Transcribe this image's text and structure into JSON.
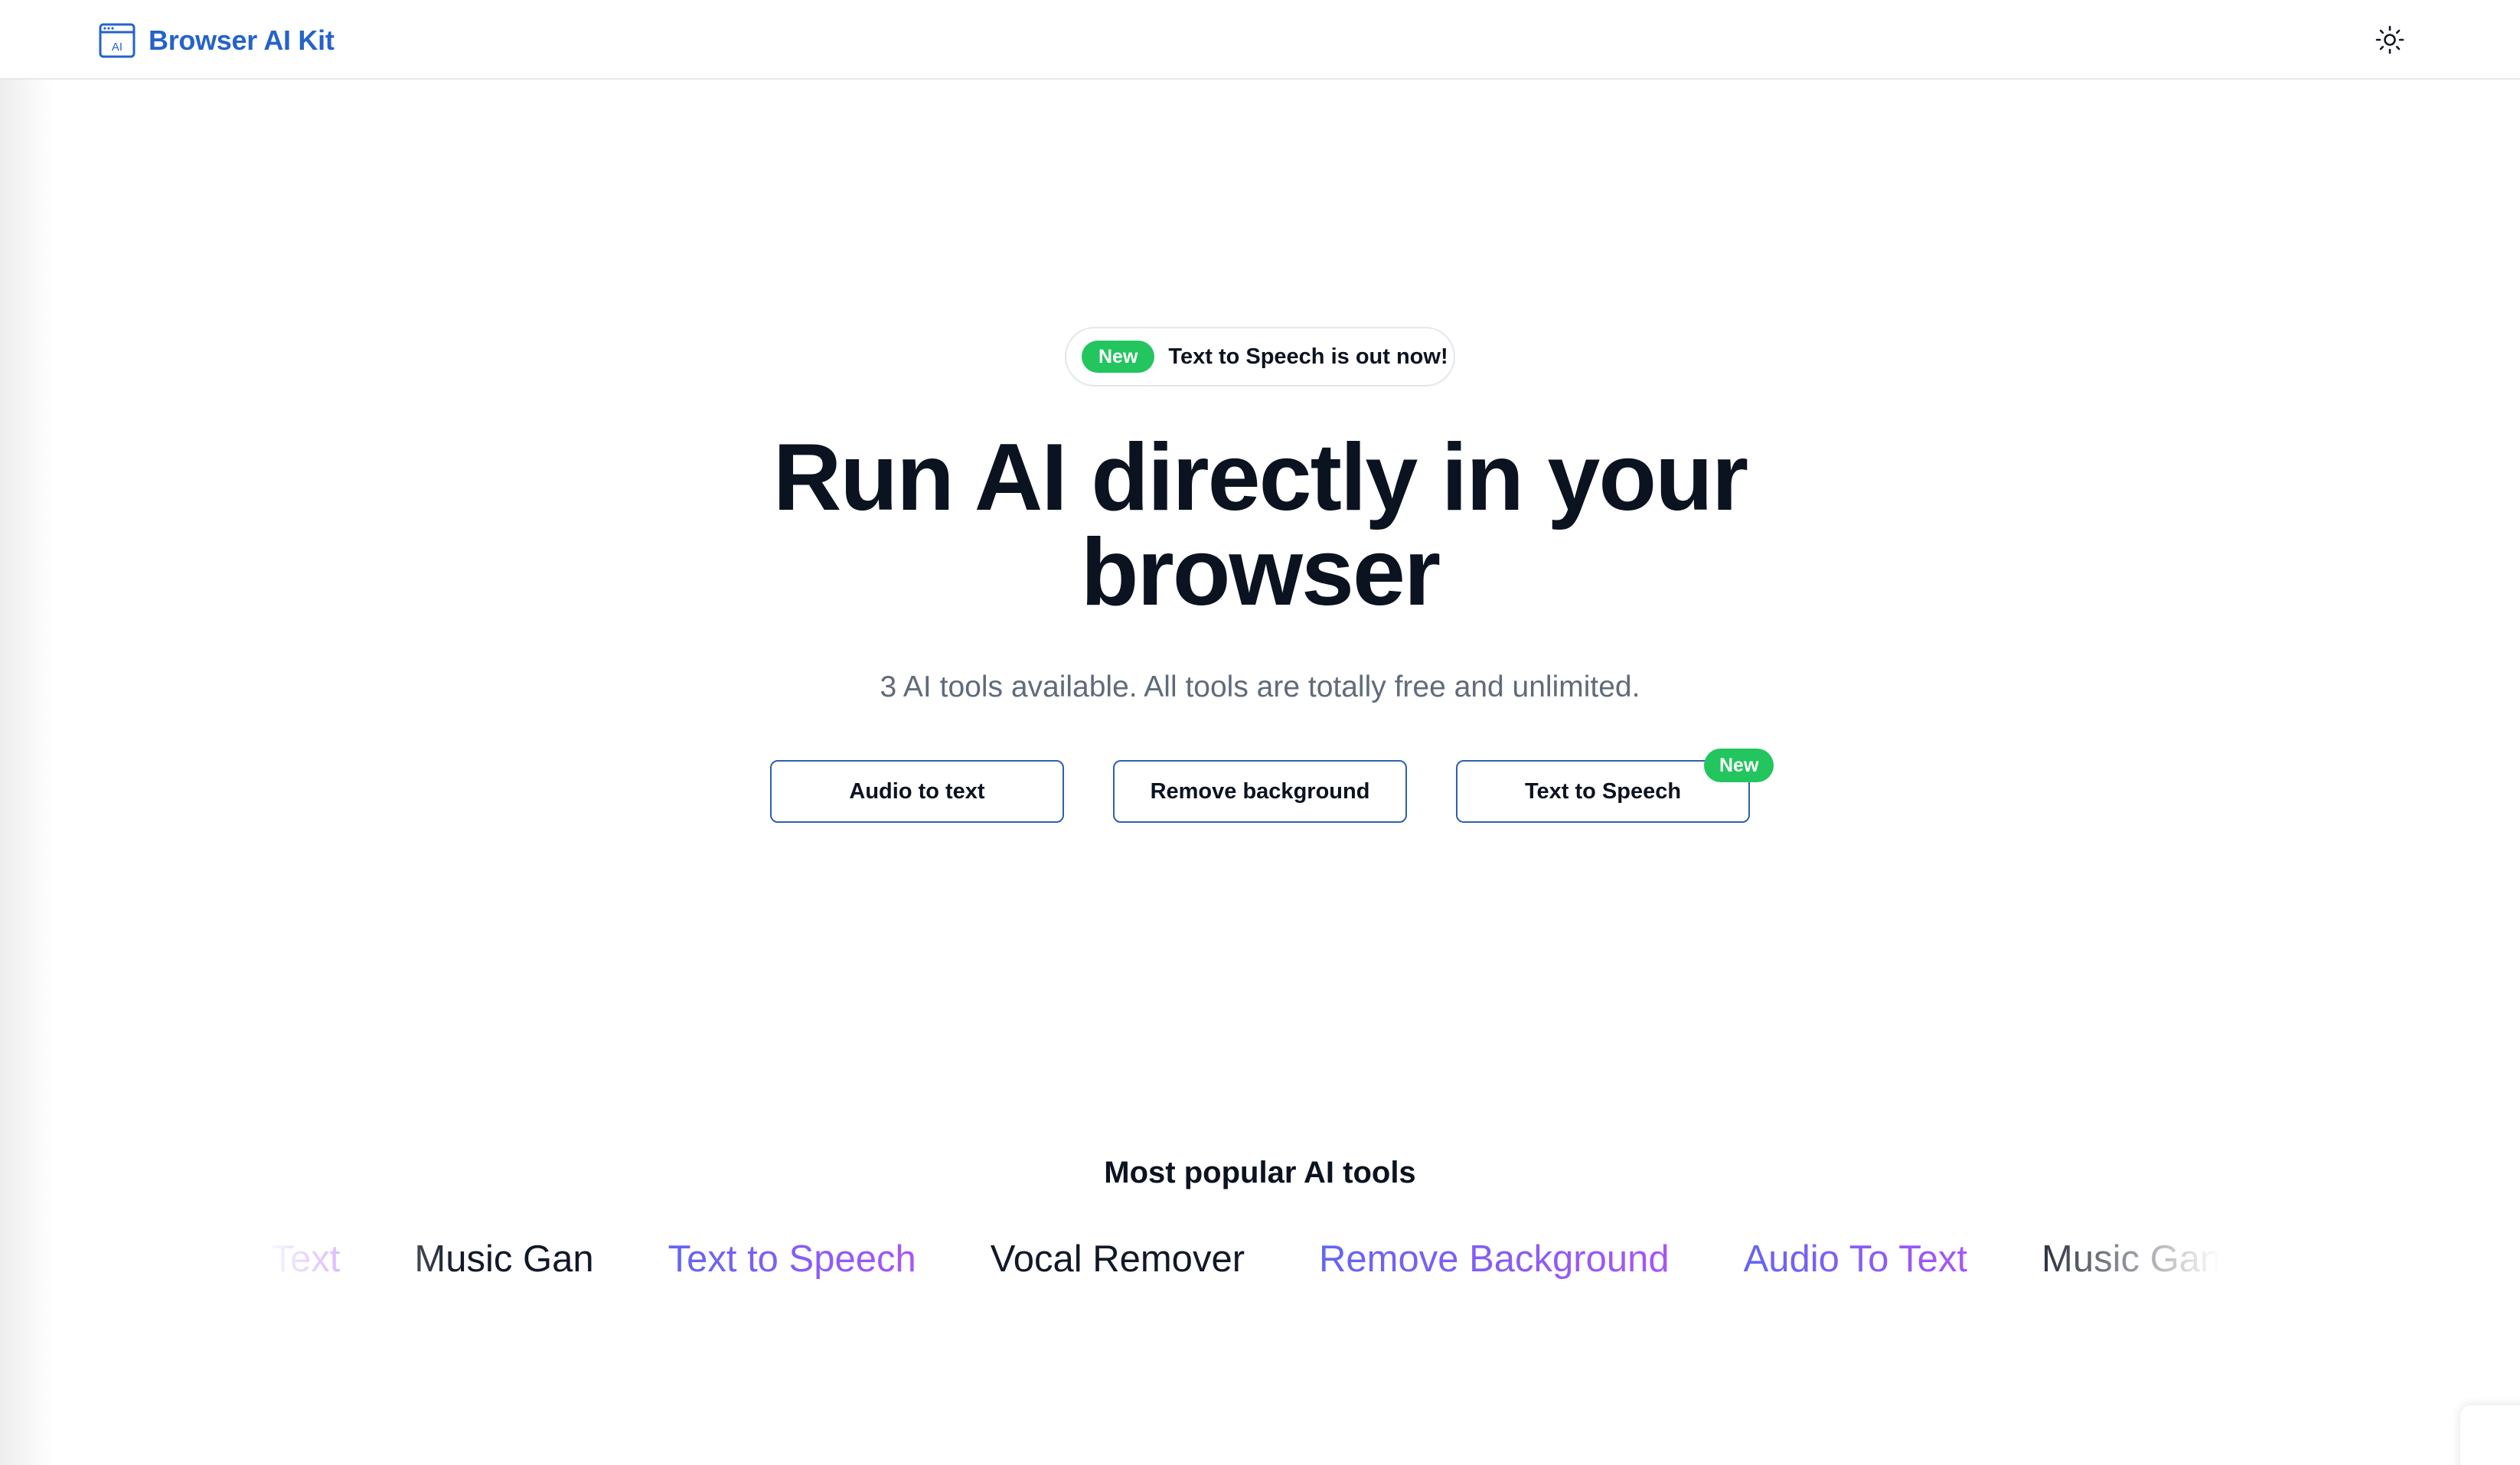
{
  "header": {
    "brand_name": "Browser AI Kit",
    "brand_icon_text": "AI",
    "brand_color": "#2563c9",
    "theme_icon": "sun-icon"
  },
  "announcement": {
    "badge": "New",
    "text": "Text to Speech is out now!",
    "badge_color": "#22c55e"
  },
  "hero": {
    "title_line1": "Run AI directly in your",
    "title_line2": "browser",
    "subtitle": "3 AI tools available. All tools are totally free and unlimited."
  },
  "tools": [
    {
      "label": "Audio to text"
    },
    {
      "label": "Remove background"
    },
    {
      "label": "Text to Speech",
      "badge": "New"
    }
  ],
  "popular": {
    "title": "Most popular AI tools",
    "items": [
      "Audio To Text",
      "Music Gan",
      "Text to Speech",
      "Vocal Remover",
      "Remove Background",
      "Audio To Text",
      "Music Gan"
    ],
    "gradient_colors": [
      "#6366f1",
      "#a855f7"
    ]
  }
}
